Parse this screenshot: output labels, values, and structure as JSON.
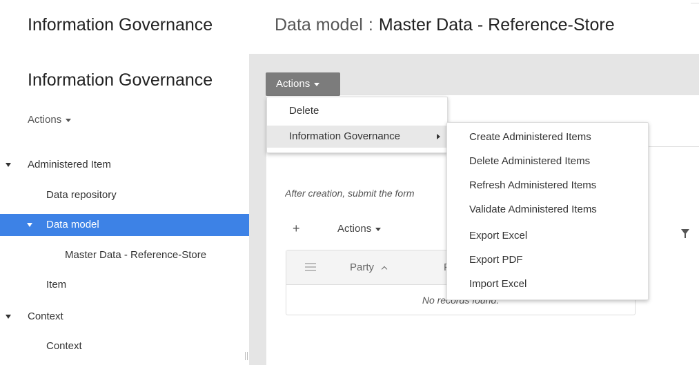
{
  "header": {
    "app_title": "Information Governance",
    "breadcrumb": {
      "section": "Data model",
      "separator": ":",
      "current": "Master Data - Reference-Store"
    }
  },
  "sidebar": {
    "title": "Information Governance",
    "actions_label": "Actions",
    "tree": [
      {
        "label": "Administered Item",
        "expandable": true
      },
      {
        "label": "Data repository"
      },
      {
        "label": "Data model",
        "expandable": true,
        "selected": true
      },
      {
        "label": "Master Data - Reference-Store"
      },
      {
        "label": "Item"
      },
      {
        "label": "Context",
        "expandable": true
      },
      {
        "label": "Context"
      }
    ]
  },
  "main": {
    "actions_label": "Actions",
    "hint": "After creation, submit the form",
    "table": {
      "add_label": "+",
      "actions_label": "Actions",
      "columns": [
        "Party",
        "F"
      ],
      "empty_message": "No records found."
    }
  },
  "actions_menu": {
    "items": [
      "Delete",
      "Information Governance"
    ]
  },
  "submenu": {
    "items": [
      "Create Administered Items",
      "Delete Administered Items",
      "Refresh Administered Items",
      "Validate Administered Items",
      "Export Excel",
      "Export PDF",
      "Import Excel"
    ]
  },
  "colors": {
    "selected": "#3d82e6",
    "action_button": "#7c7c7c",
    "content_background": "#e5e5e5"
  }
}
